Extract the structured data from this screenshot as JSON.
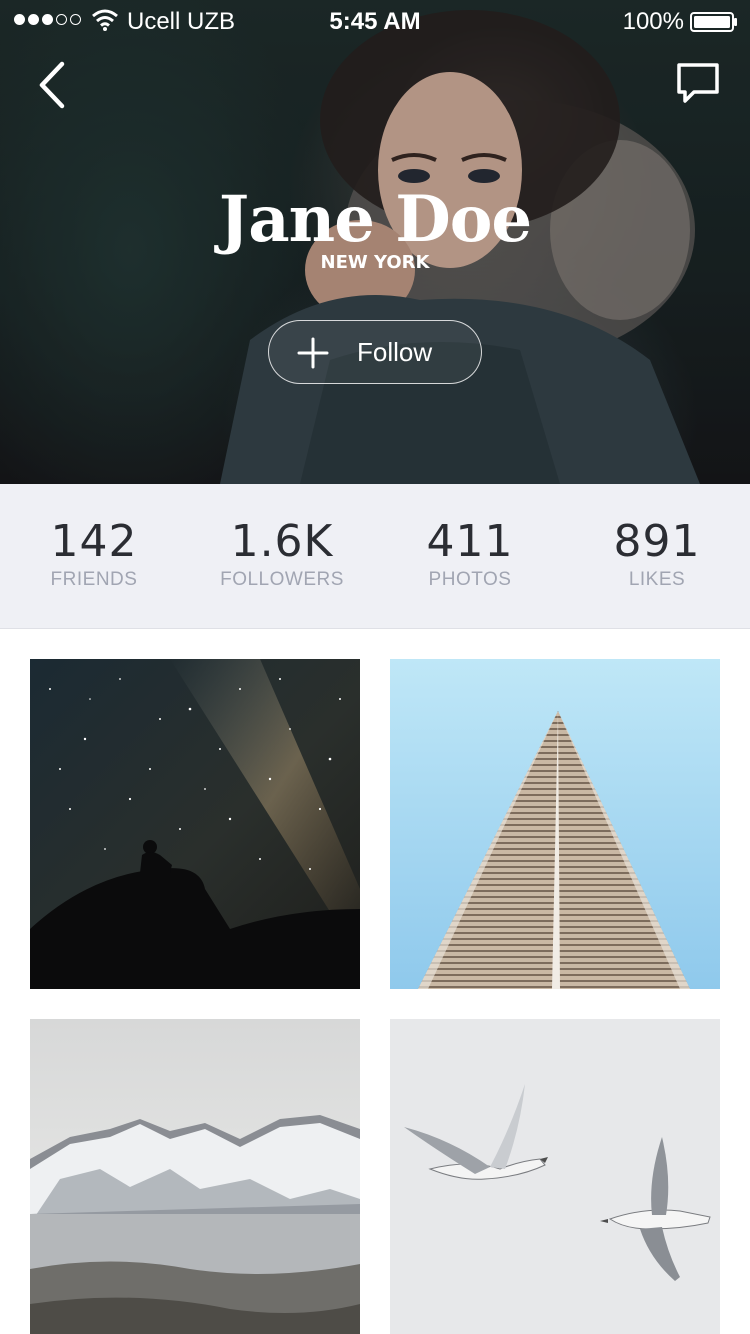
{
  "status_bar": {
    "signal_strength": 3,
    "signal_max": 5,
    "carrier": "Ucell UZB",
    "time": "5:45 AM",
    "battery_percent_text": "100%",
    "battery_level": 1.0
  },
  "nav": {
    "back_icon": "chevron-left-icon",
    "chat_icon": "chat-bubble-icon"
  },
  "profile": {
    "name": "Jane Doe",
    "location": "NEW YORK",
    "follow_label": "Follow",
    "follow_icon": "plus-icon"
  },
  "stats": [
    {
      "value": "142",
      "label": "FRIENDS"
    },
    {
      "value": "1.6K",
      "label": "FOLLOWERS"
    },
    {
      "value": "411",
      "label": "PHOTOS"
    },
    {
      "value": "891",
      "label": "LIKES"
    }
  ],
  "photos": [
    {
      "subject": "milky-way-night-sky"
    },
    {
      "subject": "skyscraper-upward-view"
    },
    {
      "subject": "snowy-mountains"
    },
    {
      "subject": "seagulls-flying"
    }
  ],
  "colors": {
    "stats_background": "#eff0f5",
    "stat_value": "#2b2d33",
    "stat_label": "#a1a5b2"
  }
}
